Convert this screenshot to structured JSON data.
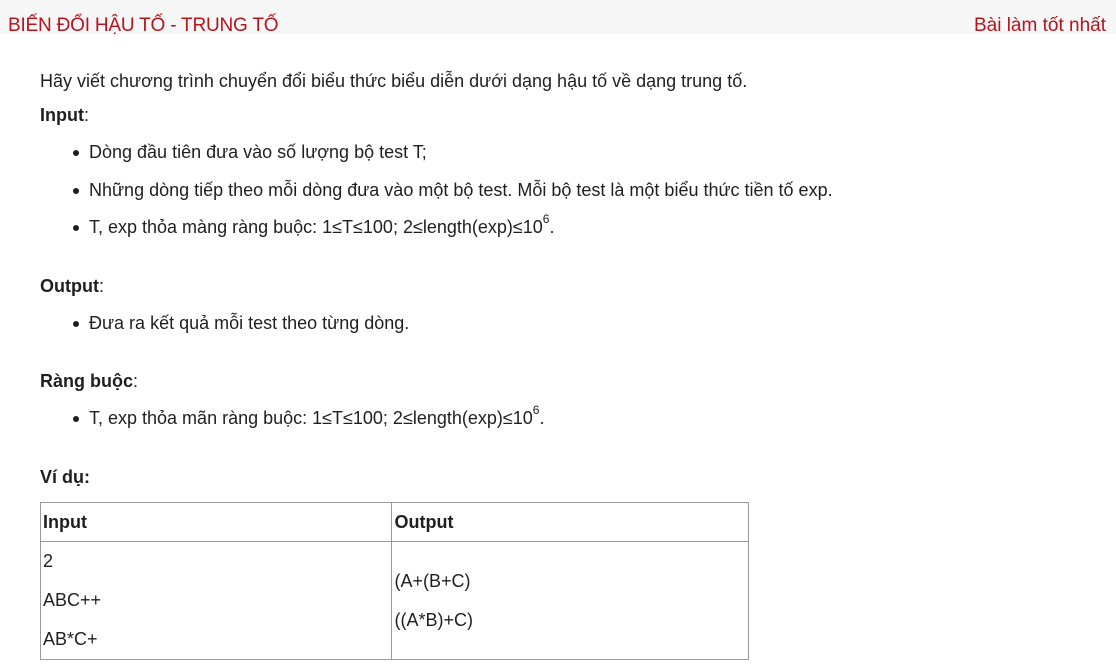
{
  "header": {
    "title": "BIẾN ĐỔI HẬU TỐ - TRUNG TỐ",
    "best_link": "Bài làm tốt nhất"
  },
  "problem": {
    "intro": "Hãy viết chương trình chuyển đổi biểu thức biểu diễn dưới dạng hậu tố về dạng trung tố.",
    "input_label": "Input",
    "input_items": [
      "Dòng đầu tiên đưa vào số lượng bộ test T;",
      "Những dòng tiếp theo mỗi dòng đưa vào một bộ test. Mỗi bộ test là một biểu thức tiền tố exp.",
      "T, exp thỏa màng ràng buộc: 1≤T≤100; 2≤length(exp)≤10"
    ],
    "input_item3_sup": "6",
    "input_item3_tail": ".",
    "output_label": "Output",
    "output_items": [
      "Đưa ra kết quả mỗi test theo từng dòng."
    ],
    "constraints_label": "Ràng buộc",
    "constraints_items": [
      "T, exp thỏa mãn ràng buộc: 1≤T≤100; 2≤length(exp)≤10"
    ],
    "constraints_sup": "6",
    "constraints_tail": ".",
    "colon": ":",
    "example_label": "Ví dụ:"
  },
  "example_table": {
    "headers": [
      "Input",
      "Output"
    ],
    "input_lines": [
      "2",
      "ABC++",
      "AB*C+"
    ],
    "output_lines": [
      "(A+(B+C)",
      "((A*B)+C)"
    ]
  },
  "colors": {
    "accent": "#b8141c",
    "header_bg": "#f7f7f7",
    "text": "#1f1f1f",
    "table_border": "#9a9a9a"
  }
}
